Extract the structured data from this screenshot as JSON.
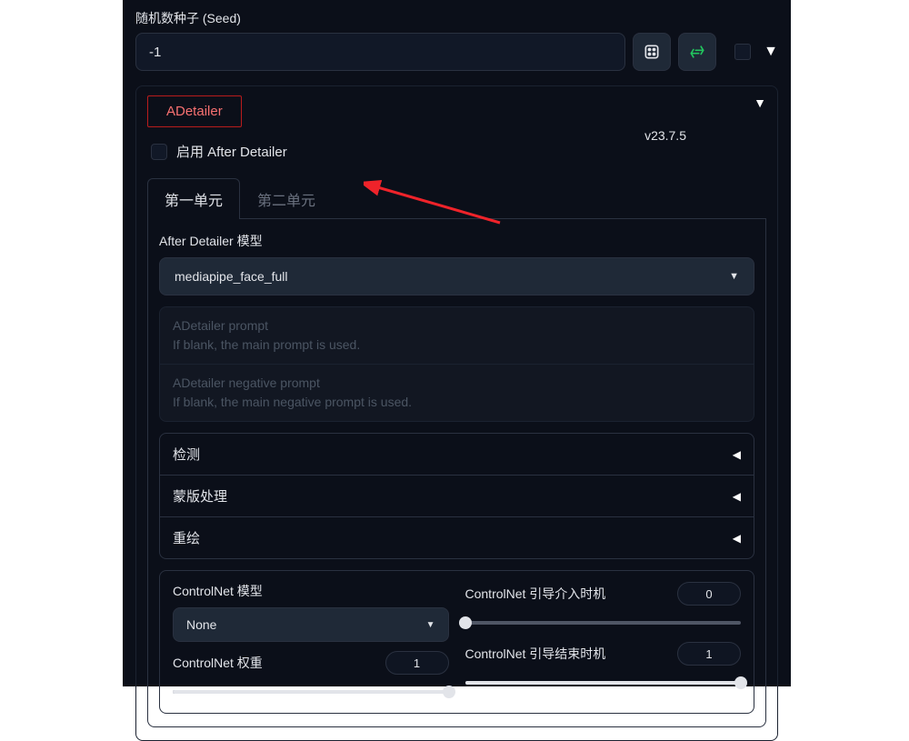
{
  "seed": {
    "label": "随机数种子 (Seed)",
    "value": "-1"
  },
  "adetailer": {
    "title": "ADetailer",
    "enable_label": "启用 After Detailer",
    "version": "v23.7.5",
    "tabs": {
      "first": "第一单元",
      "second": "第二单元"
    },
    "model": {
      "label": "After Detailer 模型",
      "value": "mediapipe_face_full"
    },
    "prompt": {
      "placeholder_title": "ADetailer prompt",
      "placeholder_sub": "If blank, the main prompt is used."
    },
    "neg_prompt": {
      "placeholder_title": "ADetailer negative prompt",
      "placeholder_sub": "If blank, the main negative prompt is used."
    },
    "accordion": {
      "detect": "检测",
      "mask": "蒙版处理",
      "inpaint": "重绘"
    },
    "controlnet": {
      "model_label": "ControlNet 模型",
      "model_value": "None",
      "weight_label": "ControlNet 权重",
      "weight_value": "1",
      "weight_pct": 100,
      "start_label": "ControlNet 引导介入时机",
      "start_value": "0",
      "start_pct": 0,
      "end_label": "ControlNet 引导结束时机",
      "end_value": "1",
      "end_pct": 100
    }
  }
}
